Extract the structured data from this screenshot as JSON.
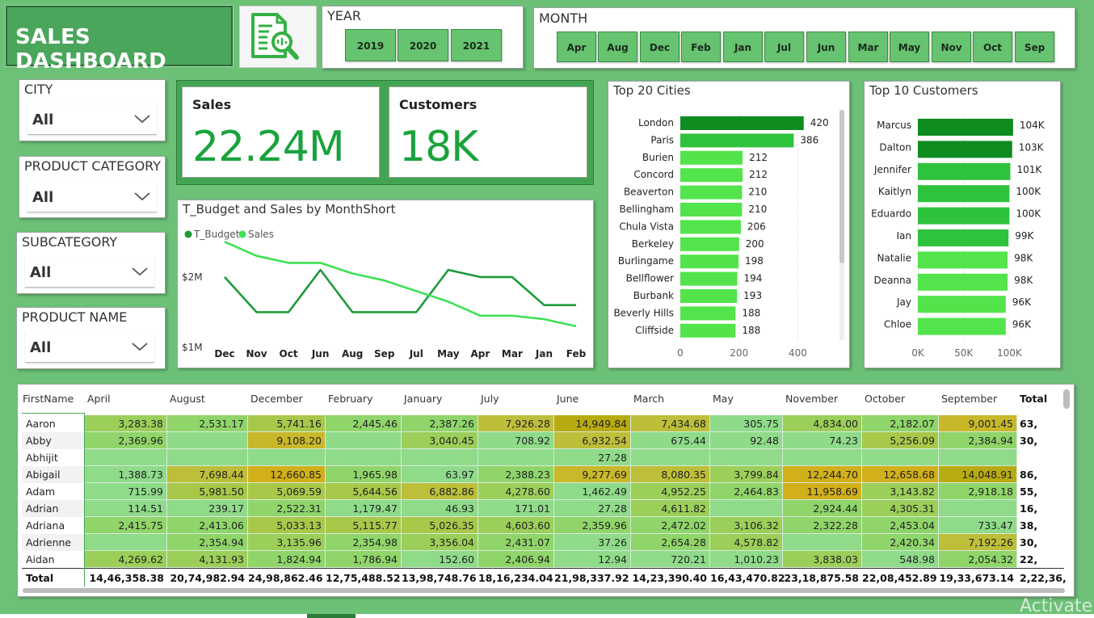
{
  "header": {
    "title": "SALES DASHBOARD"
  },
  "icons": {
    "report": "report-search-icon",
    "chevron": "chevron-down-icon"
  },
  "year_slicer": {
    "title": "YEAR",
    "options": [
      "2019",
      "2020",
      "2021"
    ]
  },
  "month_slicer": {
    "title": "MONTH",
    "options": [
      "Apr",
      "Aug",
      "Dec",
      "Feb",
      "Jan",
      "Jul",
      "Jun",
      "Mar",
      "May",
      "Nov",
      "Oct",
      "Sep"
    ]
  },
  "filters": [
    {
      "label": "CITY",
      "value": "All"
    },
    {
      "label": "PRODUCT CATEGORY",
      "value": "All"
    },
    {
      "label": "SUBCATEGORY",
      "value": "All"
    },
    {
      "label": "PRODUCT NAME",
      "value": "All"
    }
  ],
  "kpis": [
    {
      "label": "Sales",
      "value": "22.24M"
    },
    {
      "label": "Customers",
      "value": "18K"
    }
  ],
  "colors": {
    "primary": "#1aa33c",
    "background": "#6cc177",
    "title_bg": "#4aa65b"
  },
  "chart_data": [
    {
      "type": "line",
      "title": "T_Budget and Sales by MonthShort",
      "legend_position": "top-left",
      "categories": [
        "Dec",
        "Nov",
        "Oct",
        "Jun",
        "Aug",
        "Sep",
        "Jul",
        "May",
        "Apr",
        "Mar",
        "Jan",
        "Feb"
      ],
      "y_ticks": [
        "$2M",
        "$1M"
      ],
      "ylim": [
        1.0,
        2.4
      ],
      "series": [
        {
          "name": "T_Budget",
          "color": "#1f9a3a",
          "values": [
            2.0,
            1.5,
            1.5,
            2.1,
            1.5,
            1.5,
            1.5,
            2.1,
            2.0,
            2.0,
            1.6,
            1.6
          ]
        },
        {
          "name": "Sales",
          "color": "#3fe055",
          "values": [
            2.5,
            2.3,
            2.2,
            2.2,
            2.05,
            1.95,
            1.8,
            1.65,
            1.45,
            1.45,
            1.4,
            1.3
          ]
        }
      ]
    },
    {
      "type": "bar",
      "orientation": "horizontal",
      "title": "Top 20 Cities",
      "categories": [
        "London",
        "Paris",
        "Burien",
        "Concord",
        "Beaverton",
        "Bellingham",
        "Chula Vista",
        "Berkeley",
        "Burlingame",
        "Bellflower",
        "Burbank",
        "Beverly Hills",
        "Cliffside"
      ],
      "values": [
        420,
        386,
        212,
        212,
        210,
        210,
        206,
        200,
        198,
        194,
        193,
        188,
        188
      ],
      "x_ticks": [
        "0",
        "200",
        "400"
      ],
      "xlim": [
        0,
        440
      ]
    },
    {
      "type": "bar",
      "orientation": "horizontal",
      "title": "Top 10 Customers",
      "categories": [
        "Marcus",
        "Dalton",
        "Jennifer",
        "Kaitlyn",
        "Eduardo",
        "Ian",
        "Natalie",
        "Deanna",
        "Jay",
        "Chloe"
      ],
      "values": [
        104,
        103,
        101,
        100,
        100,
        99,
        98,
        98,
        96,
        96
      ],
      "value_labels": [
        "104K",
        "103K",
        "101K",
        "100K",
        "100K",
        "99K",
        "98K",
        "98K",
        "96K",
        "96K"
      ],
      "x_ticks": [
        "0K",
        "50K",
        "100K"
      ],
      "xlim": [
        0,
        120
      ]
    }
  ],
  "table": {
    "headers": [
      "FirstName",
      "April",
      "August",
      "December",
      "February",
      "January",
      "July",
      "June",
      "March",
      "May",
      "November",
      "October",
      "September",
      "Total"
    ],
    "rows": [
      {
        "name": "Aaron",
        "cells": [
          "3,283.38",
          "2,531.17",
          "5,741.16",
          "2,445.46",
          "2,387.26",
          "7,926.28",
          "14,949.84",
          "7,434.68",
          "305.75",
          "4,834.00",
          "2,182.07",
          "9,001.45"
        ],
        "total": "63,"
      },
      {
        "name": "Abby",
        "cells": [
          "2,369.96",
          "",
          "9,108.20",
          "",
          "3,040.45",
          "708.92",
          "6,932.54",
          "675.44",
          "92.48",
          "74.23",
          "5,256.09",
          "2,384.94"
        ],
        "total": "30,"
      },
      {
        "name": "Abhijit",
        "cells": [
          "",
          "",
          "",
          "",
          "",
          "",
          "27.28",
          "",
          "",
          "",
          "",
          ""
        ],
        "total": ""
      },
      {
        "name": "Abigail",
        "cells": [
          "1,388.73",
          "7,698.44",
          "12,660.85",
          "1,965.98",
          "63.97",
          "2,388.23",
          "9,277.69",
          "8,080.35",
          "3,799.84",
          "12,244.70",
          "12,658.68",
          "14,048.91"
        ],
        "total": "86,"
      },
      {
        "name": "Adam",
        "cells": [
          "715.99",
          "5,981.50",
          "5,069.59",
          "5,644.56",
          "6,882.86",
          "4,278.60",
          "1,462.49",
          "4,952.25",
          "2,464.83",
          "11,958.69",
          "3,143.82",
          "2,918.18"
        ],
        "total": "55,"
      },
      {
        "name": "Adrian",
        "cells": [
          "114.51",
          "239.17",
          "2,522.31",
          "1,179.47",
          "46.93",
          "171.01",
          "27.28",
          "4,611.82",
          "",
          "2,924.44",
          "4,305.31",
          ""
        ],
        "total": "16,"
      },
      {
        "name": "Adriana",
        "cells": [
          "2,415.75",
          "2,413.06",
          "5,033.13",
          "5,115.77",
          "5,026.35",
          "4,603.60",
          "2,359.96",
          "2,472.02",
          "3,106.32",
          "2,322.28",
          "2,453.04",
          "733.47"
        ],
        "total": "38,"
      },
      {
        "name": "Adrienne",
        "cells": [
          "",
          "2,354.94",
          "3,135.96",
          "2,354.98",
          "3,356.04",
          "2,431.07",
          "37.26",
          "2,654.28",
          "4,578.82",
          "",
          "2,420.34",
          "7,192.26"
        ],
        "total": "30,"
      },
      {
        "name": "Aidan",
        "cells": [
          "4,269.62",
          "4,131.93",
          "1,824.94",
          "1,786.94",
          "152.60",
          "2,406.94",
          "12.94",
          "720.21",
          "1,010.23",
          "3,838.03",
          "548.98",
          "2,054.32"
        ],
        "total": "22,"
      }
    ],
    "totals_label": "Total",
    "totals": [
      "14,46,358.38",
      "20,74,982.94",
      "24,98,862.46",
      "12,75,488.52",
      "13,98,748.76",
      "18,16,234.04",
      "21,98,337.92",
      "14,23,390.40",
      "16,43,470.82",
      "23,18,875.58",
      "22,08,452.89",
      "19,33,673.14",
      "2,22,36,"
    ]
  }
}
